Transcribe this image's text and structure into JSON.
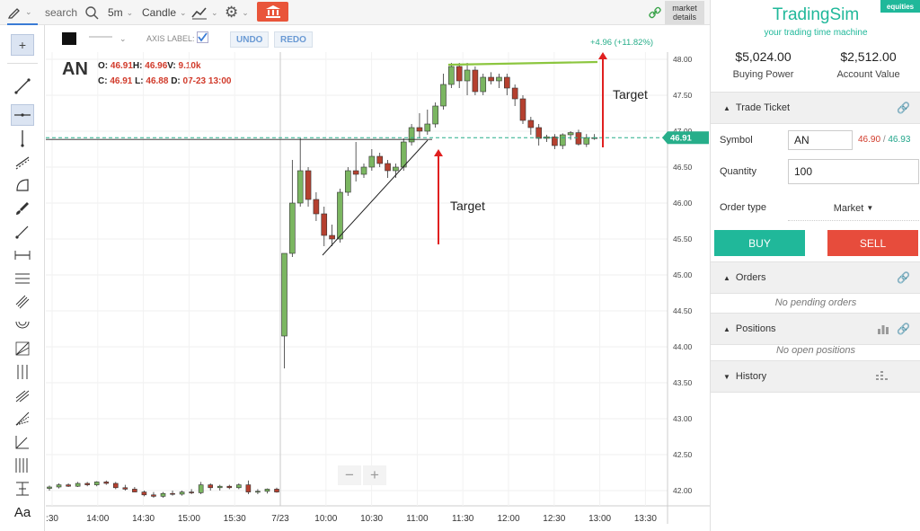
{
  "toolbar": {
    "search_label": "search",
    "interval": "5m",
    "chart_style": "Candle",
    "market_details_line1": "market",
    "market_details_line2": "details"
  },
  "chart_options": {
    "axis_label": "AXIS LABEL:",
    "undo": "UNDO",
    "redo": "REDO"
  },
  "symbol_info": {
    "symbol": "AN",
    "o_label": "O:",
    "o_value": "46.91",
    "h_label": "H:",
    "h_value": "46.96",
    "v_label": "V:",
    "v_value": "9.10k",
    "c_label": "C:",
    "c_value": "46.91",
    "l_label": "L:",
    "l_value": "46.88",
    "d_label": "D:",
    "d_value": "07-23 13:00"
  },
  "annotations": {
    "change_label": "+4.96 (+11.82%)",
    "target_upper": "Target",
    "target_lower": "Target",
    "price_marker": "46.91"
  },
  "zoom": {
    "minus": "−",
    "plus": "+"
  },
  "colors": {
    "up": "#7bb661",
    "down": "#b5402f",
    "accent_teal": "#20b89a",
    "sell_red": "#e74c3c",
    "brand_red": "#e9553a"
  },
  "chart_data": {
    "type": "candlestick",
    "ylim": [
      41.8,
      48.1
    ],
    "y_ticks": [
      "48.00",
      "47.50",
      "47.00",
      "46.50",
      "46.00",
      "45.50",
      "45.00",
      "44.50",
      "44.00",
      "43.50",
      "43.00",
      "42.50",
      "42.00"
    ],
    "x_ticks": [
      ":30",
      "14:00",
      "14:30",
      "15:00",
      "15:30",
      "7/23",
      "10:00",
      "10:30",
      "11:00",
      "11:30",
      "12:00",
      "12:30",
      "13:00",
      "13:30"
    ],
    "candles": [
      {
        "o": 42.03,
        "h": 42.07,
        "l": 42.0,
        "c": 42.05
      },
      {
        "o": 42.05,
        "h": 42.1,
        "l": 42.03,
        "c": 42.08
      },
      {
        "o": 42.08,
        "h": 42.1,
        "l": 42.05,
        "c": 42.06
      },
      {
        "o": 42.06,
        "h": 42.12,
        "l": 42.05,
        "c": 42.1
      },
      {
        "o": 42.1,
        "h": 42.12,
        "l": 42.06,
        "c": 42.08
      },
      {
        "o": 42.08,
        "h": 42.13,
        "l": 42.06,
        "c": 42.12
      },
      {
        "o": 42.12,
        "h": 42.14,
        "l": 42.08,
        "c": 42.1
      },
      {
        "o": 42.1,
        "h": 42.12,
        "l": 42.02,
        "c": 42.04
      },
      {
        "o": 42.04,
        "h": 42.08,
        "l": 42.0,
        "c": 42.02
      },
      {
        "o": 42.02,
        "h": 42.05,
        "l": 41.98,
        "c": 41.98
      },
      {
        "o": 41.98,
        "h": 42.0,
        "l": 41.92,
        "c": 41.94
      },
      {
        "o": 41.94,
        "h": 41.98,
        "l": 41.9,
        "c": 41.92
      },
      {
        "o": 41.92,
        "h": 41.98,
        "l": 41.9,
        "c": 41.96
      },
      {
        "o": 41.96,
        "h": 42.0,
        "l": 41.93,
        "c": 41.95
      },
      {
        "o": 41.95,
        "h": 42.0,
        "l": 41.93,
        "c": 41.98
      },
      {
        "o": 41.98,
        "h": 42.02,
        "l": 41.95,
        "c": 41.97
      },
      {
        "o": 41.97,
        "h": 42.12,
        "l": 41.95,
        "c": 42.08
      },
      {
        "o": 42.08,
        "h": 42.1,
        "l": 42.0,
        "c": 42.04
      },
      {
        "o": 42.04,
        "h": 42.08,
        "l": 42.0,
        "c": 42.06
      },
      {
        "o": 42.06,
        "h": 42.08,
        "l": 42.02,
        "c": 42.04
      },
      {
        "o": 42.04,
        "h": 42.1,
        "l": 42.02,
        "c": 42.08
      },
      {
        "o": 42.08,
        "h": 42.14,
        "l": 41.95,
        "c": 41.98
      },
      {
        "o": 41.98,
        "h": 42.02,
        "l": 41.95,
        "c": 41.99
      },
      {
        "o": 41.99,
        "h": 42.03,
        "l": 41.96,
        "c": 42.02
      },
      {
        "o": 42.02,
        "h": 42.04,
        "l": 41.97,
        "c": 41.98
      },
      {
        "o": 44.15,
        "h": 45.3,
        "l": 43.7,
        "c": 45.3
      },
      {
        "o": 45.3,
        "h": 46.6,
        "l": 45.25,
        "c": 46.0
      },
      {
        "o": 46.0,
        "h": 46.9,
        "l": 45.95,
        "c": 46.45
      },
      {
        "o": 46.45,
        "h": 46.5,
        "l": 45.95,
        "c": 46.05
      },
      {
        "o": 46.05,
        "h": 46.15,
        "l": 45.75,
        "c": 45.85
      },
      {
        "o": 45.85,
        "h": 45.95,
        "l": 45.4,
        "c": 45.55
      },
      {
        "o": 45.55,
        "h": 45.7,
        "l": 45.4,
        "c": 45.5
      },
      {
        "o": 45.5,
        "h": 46.2,
        "l": 45.45,
        "c": 46.15
      },
      {
        "o": 46.15,
        "h": 46.5,
        "l": 46.1,
        "c": 46.45
      },
      {
        "o": 46.45,
        "h": 46.85,
        "l": 46.3,
        "c": 46.4
      },
      {
        "o": 46.4,
        "h": 46.55,
        "l": 46.35,
        "c": 46.5
      },
      {
        "o": 46.5,
        "h": 46.75,
        "l": 46.45,
        "c": 46.65
      },
      {
        "o": 46.65,
        "h": 46.7,
        "l": 46.5,
        "c": 46.55
      },
      {
        "o": 46.55,
        "h": 46.6,
        "l": 46.35,
        "c": 46.45
      },
      {
        "o": 46.45,
        "h": 46.55,
        "l": 46.35,
        "c": 46.5
      },
      {
        "o": 46.5,
        "h": 46.9,
        "l": 46.45,
        "c": 46.85
      },
      {
        "o": 46.85,
        "h": 47.1,
        "l": 46.8,
        "c": 47.05
      },
      {
        "o": 47.05,
        "h": 47.25,
        "l": 46.9,
        "c": 47.0
      },
      {
        "o": 47.0,
        "h": 47.3,
        "l": 46.95,
        "c": 47.1
      },
      {
        "o": 47.1,
        "h": 47.4,
        "l": 47.05,
        "c": 47.35
      },
      {
        "o": 47.35,
        "h": 47.8,
        "l": 47.3,
        "c": 47.65
      },
      {
        "o": 47.65,
        "h": 47.95,
        "l": 47.6,
        "c": 47.9
      },
      {
        "o": 47.9,
        "h": 47.95,
        "l": 47.6,
        "c": 47.7
      },
      {
        "o": 47.7,
        "h": 47.95,
        "l": 47.5,
        "c": 47.85
      },
      {
        "o": 47.85,
        "h": 47.9,
        "l": 47.5,
        "c": 47.55
      },
      {
        "o": 47.55,
        "h": 47.8,
        "l": 47.5,
        "c": 47.75
      },
      {
        "o": 47.75,
        "h": 47.82,
        "l": 47.65,
        "c": 47.7
      },
      {
        "o": 47.7,
        "h": 47.8,
        "l": 47.6,
        "c": 47.75
      },
      {
        "o": 47.75,
        "h": 47.8,
        "l": 47.5,
        "c": 47.6
      },
      {
        "o": 47.6,
        "h": 47.65,
        "l": 47.35,
        "c": 47.45
      },
      {
        "o": 47.45,
        "h": 47.5,
        "l": 47.1,
        "c": 47.15
      },
      {
        "o": 47.15,
        "h": 47.2,
        "l": 46.95,
        "c": 47.05
      },
      {
        "o": 47.05,
        "h": 47.1,
        "l": 46.8,
        "c": 46.9
      },
      {
        "o": 46.9,
        "h": 46.95,
        "l": 46.85,
        "c": 46.92
      },
      {
        "o": 46.92,
        "h": 46.96,
        "l": 46.75,
        "c": 46.8
      },
      {
        "o": 46.8,
        "h": 46.97,
        "l": 46.75,
        "c": 46.95
      },
      {
        "o": 46.95,
        "h": 47.0,
        "l": 46.88,
        "c": 46.98
      },
      {
        "o": 46.98,
        "h": 47.02,
        "l": 46.8,
        "c": 46.82
      },
      {
        "o": 46.82,
        "h": 46.96,
        "l": 46.78,
        "c": 46.91
      },
      {
        "o": 46.91,
        "h": 46.96,
        "l": 46.88,
        "c": 46.91
      }
    ]
  },
  "brand": {
    "name": "TradingSim",
    "badge": "equities",
    "tagline": "your trading time machine"
  },
  "account": {
    "buying_power_value": "$5,024.00",
    "buying_power_label": "Buying Power",
    "account_value_value": "$2,512.00",
    "account_value_label": "Account Value"
  },
  "trade_ticket": {
    "title": "Trade Ticket",
    "symbol_label": "Symbol",
    "symbol_value": "AN",
    "bid": "46.90",
    "separator": "/",
    "ask": "46.93",
    "quantity_label": "Quantity",
    "quantity_value": "100",
    "order_type_label": "Order type",
    "order_type_value": "Market",
    "buy": "BUY",
    "sell": "SELL"
  },
  "orders": {
    "title": "Orders",
    "empty": "No pending orders"
  },
  "positions": {
    "title": "Positions",
    "empty": "No open positions"
  },
  "history": {
    "title": "History"
  }
}
